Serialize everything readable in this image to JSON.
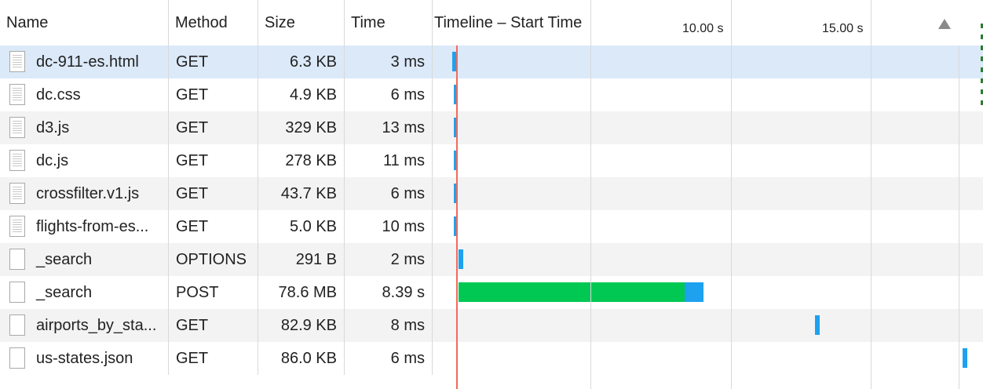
{
  "columns": {
    "name": "Name",
    "method": "Method",
    "size": "Size",
    "time": "Time",
    "timeline": "Timeline – Start Time"
  },
  "timeline_ticks": [
    "10.00 s",
    "15.00 s"
  ],
  "sort_indicator": "sort-ascending-icon",
  "colors": {
    "selected_row": "#dbe9f9",
    "waiting_bar": "#00c853",
    "receiving_bar": "#1ea1ef",
    "load_marker": "#f26a5a"
  },
  "requests": [
    {
      "name": "dc-911-es.html",
      "method": "GET",
      "size": "6.3 KB",
      "time": "3 ms",
      "icon": "document-icon"
    },
    {
      "name": "dc.css",
      "method": "GET",
      "size": "4.9 KB",
      "time": "6 ms",
      "icon": "document-icon"
    },
    {
      "name": "d3.js",
      "method": "GET",
      "size": "329 KB",
      "time": "13 ms",
      "icon": "document-icon"
    },
    {
      "name": "dc.js",
      "method": "GET",
      "size": "278 KB",
      "time": "11 ms",
      "icon": "document-icon"
    },
    {
      "name": "crossfilter.v1.js",
      "method": "GET",
      "size": "43.7 KB",
      "time": "6 ms",
      "icon": "document-icon"
    },
    {
      "name": "flights-from-es...",
      "method": "GET",
      "size": "5.0 KB",
      "time": "10 ms",
      "icon": "document-icon"
    },
    {
      "name": "_search",
      "method": "OPTIONS",
      "size": "291 B",
      "time": "2 ms",
      "icon": "blank-file-icon"
    },
    {
      "name": "_search",
      "method": "POST",
      "size": "78.6 MB",
      "time": "8.39 s",
      "icon": "blank-file-icon"
    },
    {
      "name": "airports_by_sta...",
      "method": "GET",
      "size": "82.9 KB",
      "time": "8 ms",
      "icon": "blank-file-icon"
    },
    {
      "name": "us-states.json",
      "method": "GET",
      "size": "86.0 KB",
      "time": "6 ms",
      "icon": "blank-file-icon"
    }
  ]
}
